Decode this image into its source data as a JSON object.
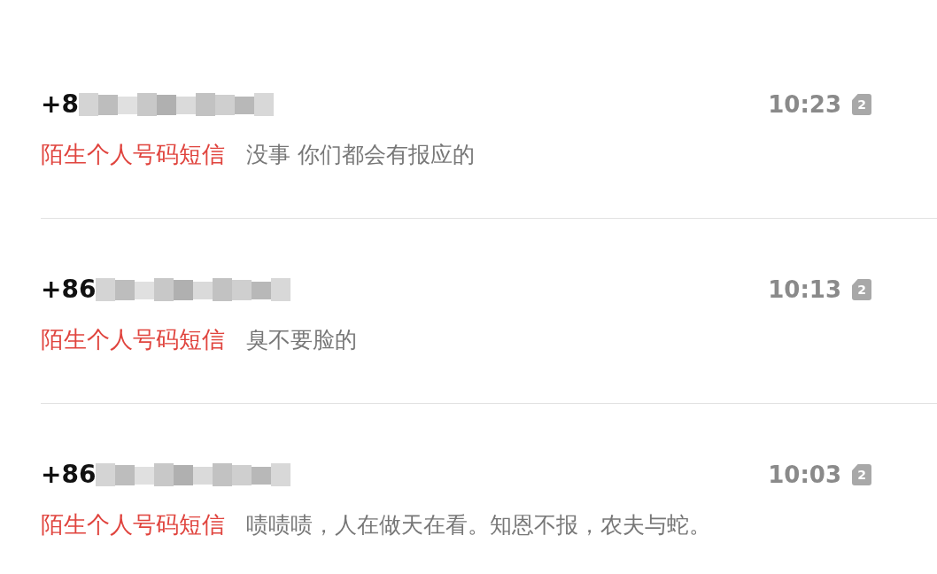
{
  "messages": [
    {
      "sender": "+8",
      "time": "10:23",
      "sim": "2",
      "label": "陌生个人号码短信",
      "preview": "没事 你们都会有报应的"
    },
    {
      "sender": "+86",
      "time": "10:13",
      "sim": "2",
      "label": "陌生个人号码短信",
      "preview": "臭不要脸的"
    },
    {
      "sender": "+86",
      "time": "10:03",
      "sim": "2",
      "label": "陌生个人号码短信",
      "preview": "啧啧啧，人在做天在看。知恩不报，农夫与蛇。"
    }
  ]
}
